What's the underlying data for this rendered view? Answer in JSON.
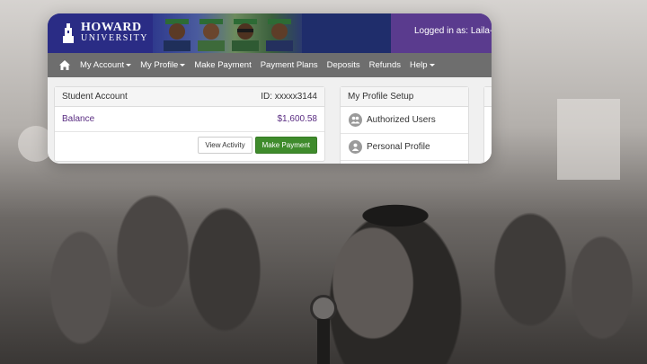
{
  "header": {
    "logo_line1": "HOWARD",
    "logo_line2": "UNIVERSITY",
    "user_status": "Logged in as: Laila-Ca"
  },
  "nav": {
    "items": [
      {
        "label": "My Account",
        "dropdown": true
      },
      {
        "label": "My Profile",
        "dropdown": true
      },
      {
        "label": "Make Payment",
        "dropdown": false
      },
      {
        "label": "Payment Plans",
        "dropdown": false
      },
      {
        "label": "Deposits",
        "dropdown": false
      },
      {
        "label": "Refunds",
        "dropdown": false
      },
      {
        "label": "Help",
        "dropdown": true
      }
    ]
  },
  "account": {
    "title": "Student Account",
    "id_text": "ID: xxxxx3144",
    "balance_label": "Balance",
    "balance_value": "$1,600.58",
    "view_activity_label": "View Activity",
    "make_payment_label": "Make Payment"
  },
  "profile": {
    "title": "My Profile Setup",
    "items": [
      {
        "label": "Authorized Users",
        "icon": "users-icon"
      },
      {
        "label": "Personal Profile",
        "icon": "user-icon"
      }
    ]
  },
  "colors": {
    "brand_navy": "#23257a",
    "brand_purple": "#5a3b8e",
    "nav_gray": "#6e6e6e",
    "balance_purple": "#5a2d82",
    "success_green": "#3f8b2c"
  }
}
